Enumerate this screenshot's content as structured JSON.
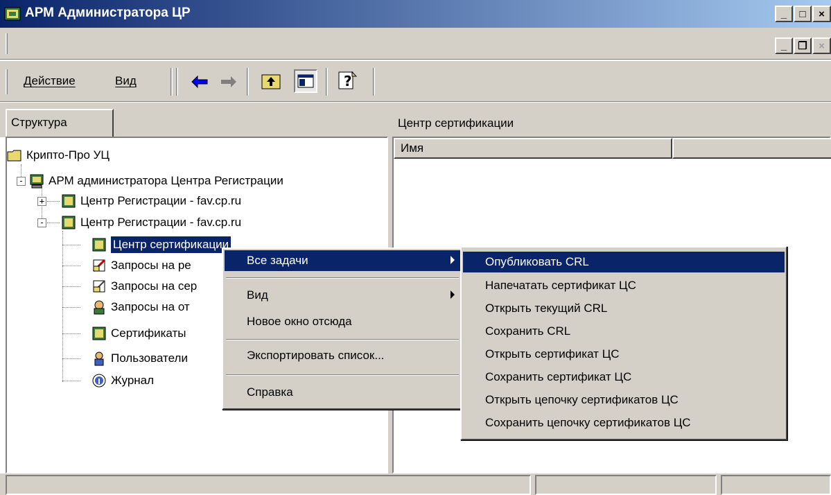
{
  "window": {
    "title": "АРМ Администратора ЦР"
  },
  "toolbar": {
    "action_label": "Действие",
    "view_label": "Вид"
  },
  "tree_panel": {
    "tab_label": "Структура"
  },
  "tree": {
    "root": "Крипто-Про УЦ",
    "arm": "АРМ администратора Центра Регистрации",
    "center1": "Центр Регистрации - fav.cp.ru",
    "center2": "Центр Регистрации - fav.cp.ru",
    "ca": "Центр сертификации",
    "req1": "Запросы на ре",
    "req2": "Запросы на сер",
    "req3": "Запросы на от",
    "certs": "Сертификаты",
    "users": "Пользователи",
    "log": "Журнал"
  },
  "right_panel": {
    "header": "Центр сертификации",
    "columns": [
      "Имя",
      ""
    ]
  },
  "context_menu": {
    "all_tasks": "Все задачи",
    "view": "Вид",
    "new_window": "Новое окно отсюда",
    "export": "Экспортировать список...",
    "help": "Справка"
  },
  "submenu": {
    "items": [
      "Опубликовать CRL",
      "Напечатать сертификат ЦС",
      "Открыть текущий CRL",
      "Сохранить CRL",
      "Открыть сертификат ЦС",
      "Сохранить сертификат ЦС",
      "Открыть цепочку сертификатов ЦС",
      "Сохранить цепочку сертификатов ЦС"
    ]
  },
  "colors": {
    "title_start": "#0a246a",
    "title_end": "#a6caf0",
    "face": "#d4d0c8",
    "highlight": "#0a246a"
  },
  "icons": [
    "mmc-icon",
    "folder-icon",
    "computer-icon",
    "cert-icon",
    "request-icon",
    "user-request-icon",
    "users-icon",
    "log-icon",
    "help-icon",
    "up-folder-icon",
    "show-tree-icon",
    "back-arrow-icon",
    "forward-arrow-icon"
  ]
}
